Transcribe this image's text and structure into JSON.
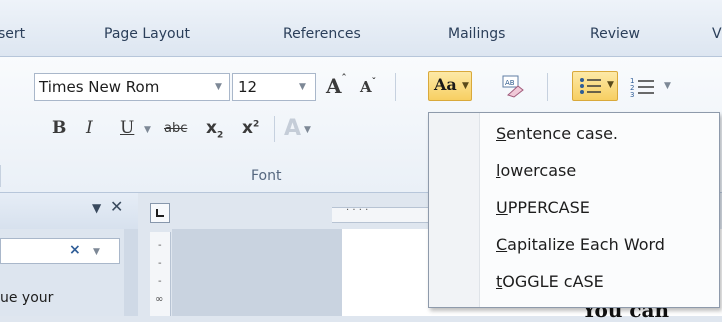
{
  "tabs": [
    "sert",
    "Page Layout",
    "References",
    "Mailings",
    "Review"
  ],
  "font_group": {
    "font_name": "Times New Rom",
    "font_size": "12",
    "grow_label": "A",
    "shrink_label": "A",
    "change_case_label": "Aa",
    "bold": "B",
    "italic": "I",
    "underline": "U",
    "strikethrough": "abc",
    "subscript": "x",
    "superscript": "x",
    "group_label": "Font"
  },
  "change_case_menu": {
    "items": [
      {
        "mnemonic": "S",
        "rest": "entence case."
      },
      {
        "mnemonic": "l",
        "rest": "owercase"
      },
      {
        "mnemonic": "U",
        "rest": "PPERCASE"
      },
      {
        "mnemonic": "C",
        "rest": "apitalize Each Word"
      },
      {
        "mnemonic": "t",
        "rest": "OGGLE cASE"
      }
    ]
  },
  "left_pane": {
    "text": "ue your"
  },
  "document": {
    "text": "You can"
  },
  "colors": {
    "ribbon_bg": "#f9fbfd",
    "highlight": "#f7cf62",
    "menu_bg": "#fbfcfd"
  },
  "icons": [
    "dropdown-arrow-icon",
    "grow-font-icon",
    "shrink-font-icon",
    "change-case-icon",
    "clear-format-icon",
    "text-effects-icon",
    "bullets-icon",
    "numbering-icon",
    "close-icon",
    "tab-stop-icon"
  ]
}
